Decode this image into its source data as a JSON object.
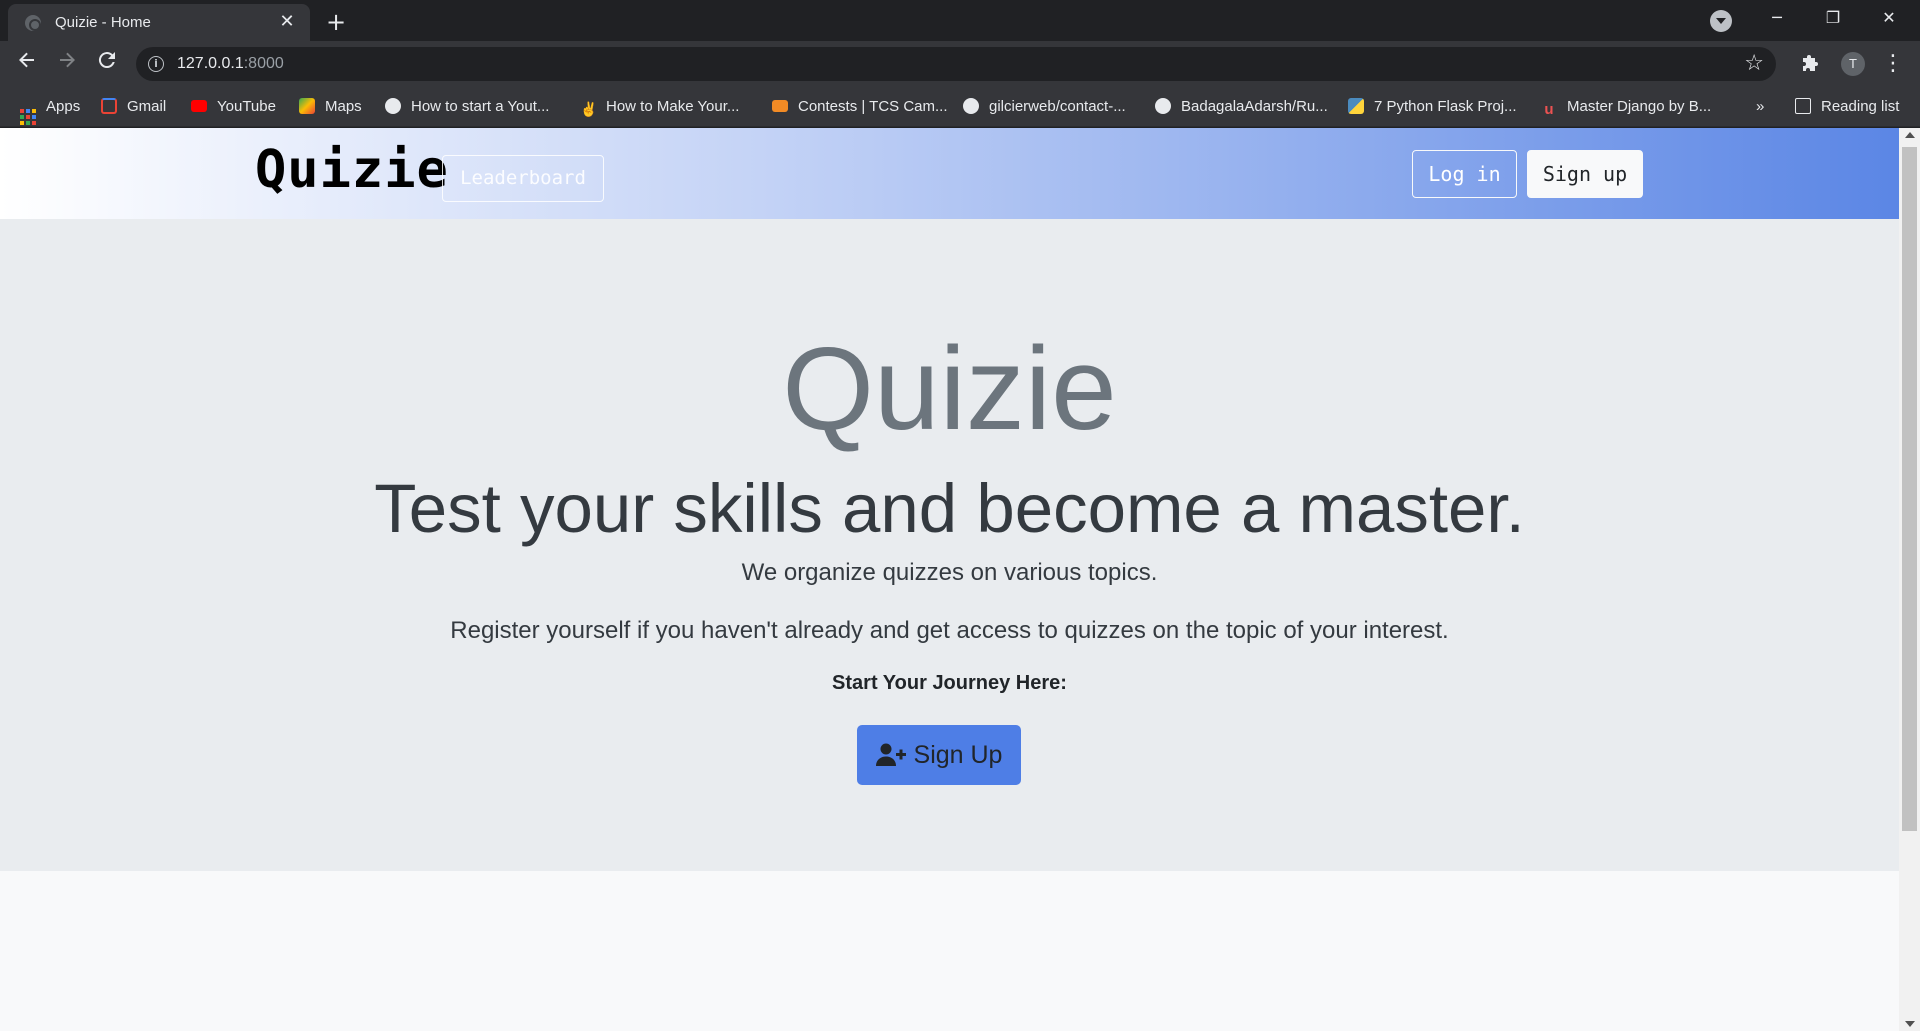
{
  "browser": {
    "tab_title": "Quizie - Home",
    "tab_close": "✕",
    "new_tab": "+",
    "window_controls": {
      "minimize": "─",
      "restore": "❐",
      "close": "✕"
    },
    "url_host": "127.0.0.1",
    "url_port": ":8000",
    "profile_initial": "T",
    "bookmarks": [
      {
        "label": "Apps",
        "icon": "apps-grid-icon"
      },
      {
        "label": "Gmail",
        "icon": "gmail-icon",
        "color": "#ea4335"
      },
      {
        "label": "YouTube",
        "icon": "youtube-icon",
        "color": "#ff0000"
      },
      {
        "label": "Maps",
        "icon": "maps-icon",
        "color": "#34a853"
      },
      {
        "label": "How to start a Yout...",
        "icon": "globe-icon",
        "color": "#e8eaed"
      },
      {
        "label": "How to Make Your...",
        "icon": "peace-hand-icon",
        "color": "#e8eaed"
      },
      {
        "label": "Contests | TCS Cam...",
        "icon": "tcs-icon",
        "color": "#f28b25"
      },
      {
        "label": "gilcierweb/contact-...",
        "icon": "github-icon",
        "color": "#e8eaed"
      },
      {
        "label": "BadagalaAdarsh/Ru...",
        "icon": "github-icon",
        "color": "#e8eaed"
      },
      {
        "label": "7 Python Flask Proj...",
        "icon": "python-icon",
        "color": "#4b8bbe"
      },
      {
        "label": "Master Django by B...",
        "icon": "udemy-icon",
        "color": "#ec5252"
      }
    ],
    "more_bookmarks": "»",
    "reading_list": "Reading list"
  },
  "navbar": {
    "brand": "Quizie",
    "leaderboard": "Leaderboard",
    "login": "Log in",
    "signup": "Sign up",
    "gradient_start": "#ffffff",
    "gradient_end": "#5b86e5"
  },
  "hero": {
    "title": "Quizie",
    "tagline": "Test your skills and become a master.",
    "line1": "We organize quizzes on various topics.",
    "line2": "Register yourself if you haven't already and get access to quizzes on the topic of your interest.",
    "start_label": "Start Your Journey Here:",
    "cta_label": "Sign Up",
    "cta_icon": "user-plus-icon",
    "cta_color": "#4e7ee6"
  }
}
